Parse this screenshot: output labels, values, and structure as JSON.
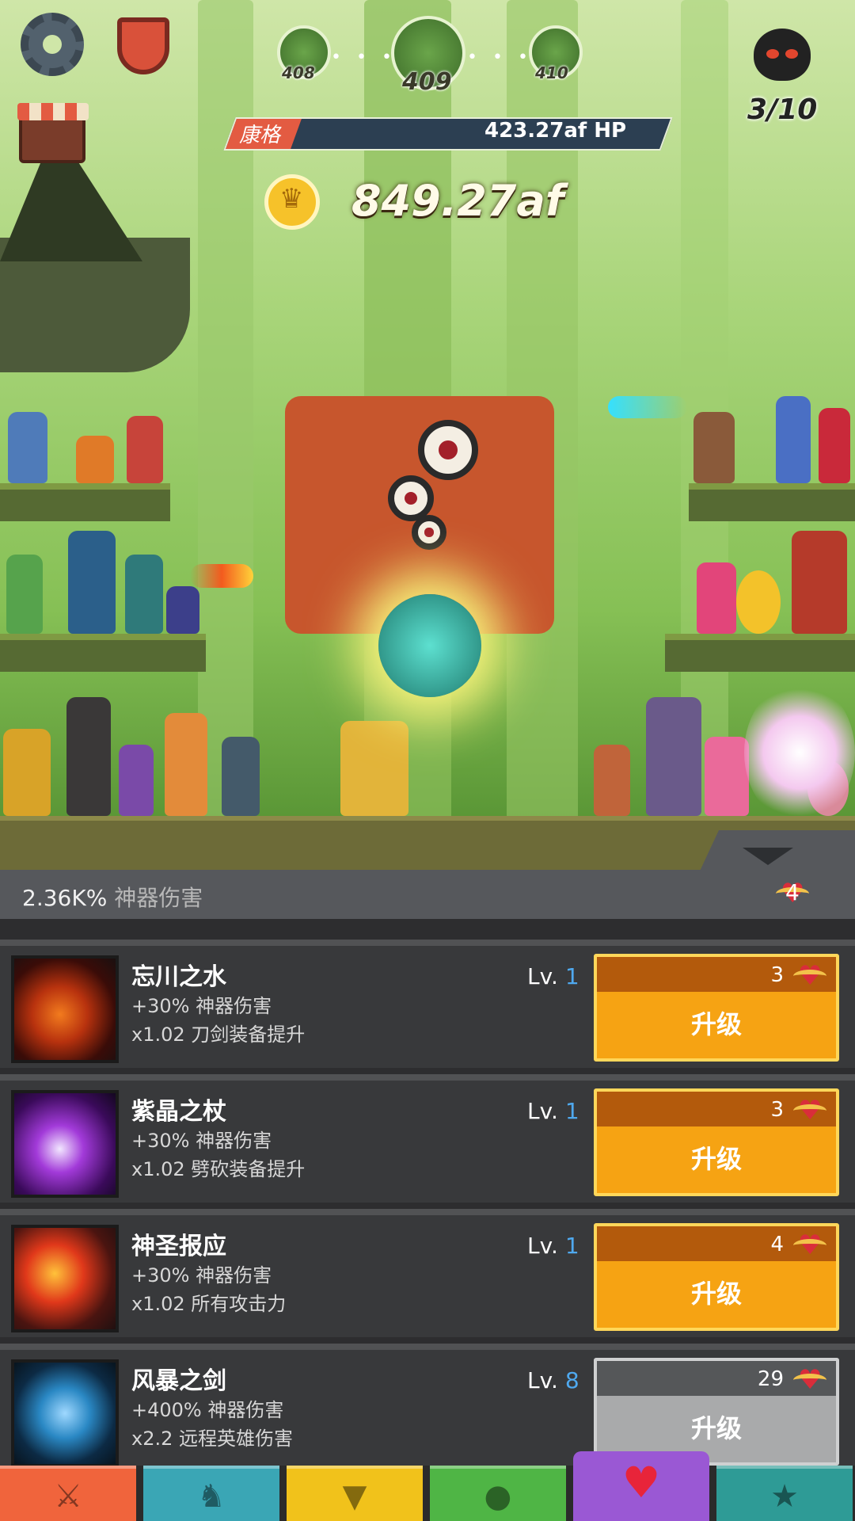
{
  "hud": {
    "stages": [
      {
        "label": "408"
      },
      {
        "label": "409"
      },
      {
        "label": "410"
      }
    ],
    "wave": "3/10",
    "boss": {
      "name": "康格",
      "hp": "423.27af HP"
    },
    "gold": "849.27af",
    "icons": {
      "settings": "gear-icon",
      "clan": "shield-icon",
      "shop": "shop-icon",
      "boss": "demon-icon",
      "coin": "coin-icon"
    }
  },
  "panel": {
    "artifact_damage_value": "2.36K%",
    "artifact_damage_label": "神器伤害",
    "relics": "4"
  },
  "artifacts": [
    {
      "name": "忘川之水",
      "line1": "+30% 神器伤害",
      "line2": "x1.02 刀剑装备提升",
      "lv_label": "Lv.",
      "lv": "1",
      "cost": "3",
      "button": "升级",
      "enabled": true
    },
    {
      "name": "紫晶之杖",
      "line1": "+30% 神器伤害",
      "line2": "x1.02 劈砍装备提升",
      "lv_label": "Lv.",
      "lv": "1",
      "cost": "3",
      "button": "升级",
      "enabled": true
    },
    {
      "name": "神圣报应",
      "line1": "+30% 神器伤害",
      "line2": "x1.02 所有攻击力",
      "lv_label": "Lv.",
      "lv": "1",
      "cost": "4",
      "button": "升级",
      "enabled": true
    },
    {
      "name": "风暴之剑",
      "line1": "+400% 神器伤害",
      "line2": "x2.2 远程英雄伤害",
      "lv_label": "Lv.",
      "lv": "8",
      "cost": "29",
      "button": "升级",
      "enabled": false
    }
  ],
  "tabs": [
    {
      "icon": "sword-icon",
      "color": "#f0643c"
    },
    {
      "icon": "knight-helmet-icon",
      "color": "#3aa6b5"
    },
    {
      "icon": "armor-icon",
      "color": "#f1c21b"
    },
    {
      "icon": "pet-icon",
      "color": "#4fb545"
    },
    {
      "icon": "winged-heart-icon",
      "color": "#9a58d4",
      "active": true
    },
    {
      "icon": "star-icon",
      "color": "#2e9b96"
    }
  ]
}
